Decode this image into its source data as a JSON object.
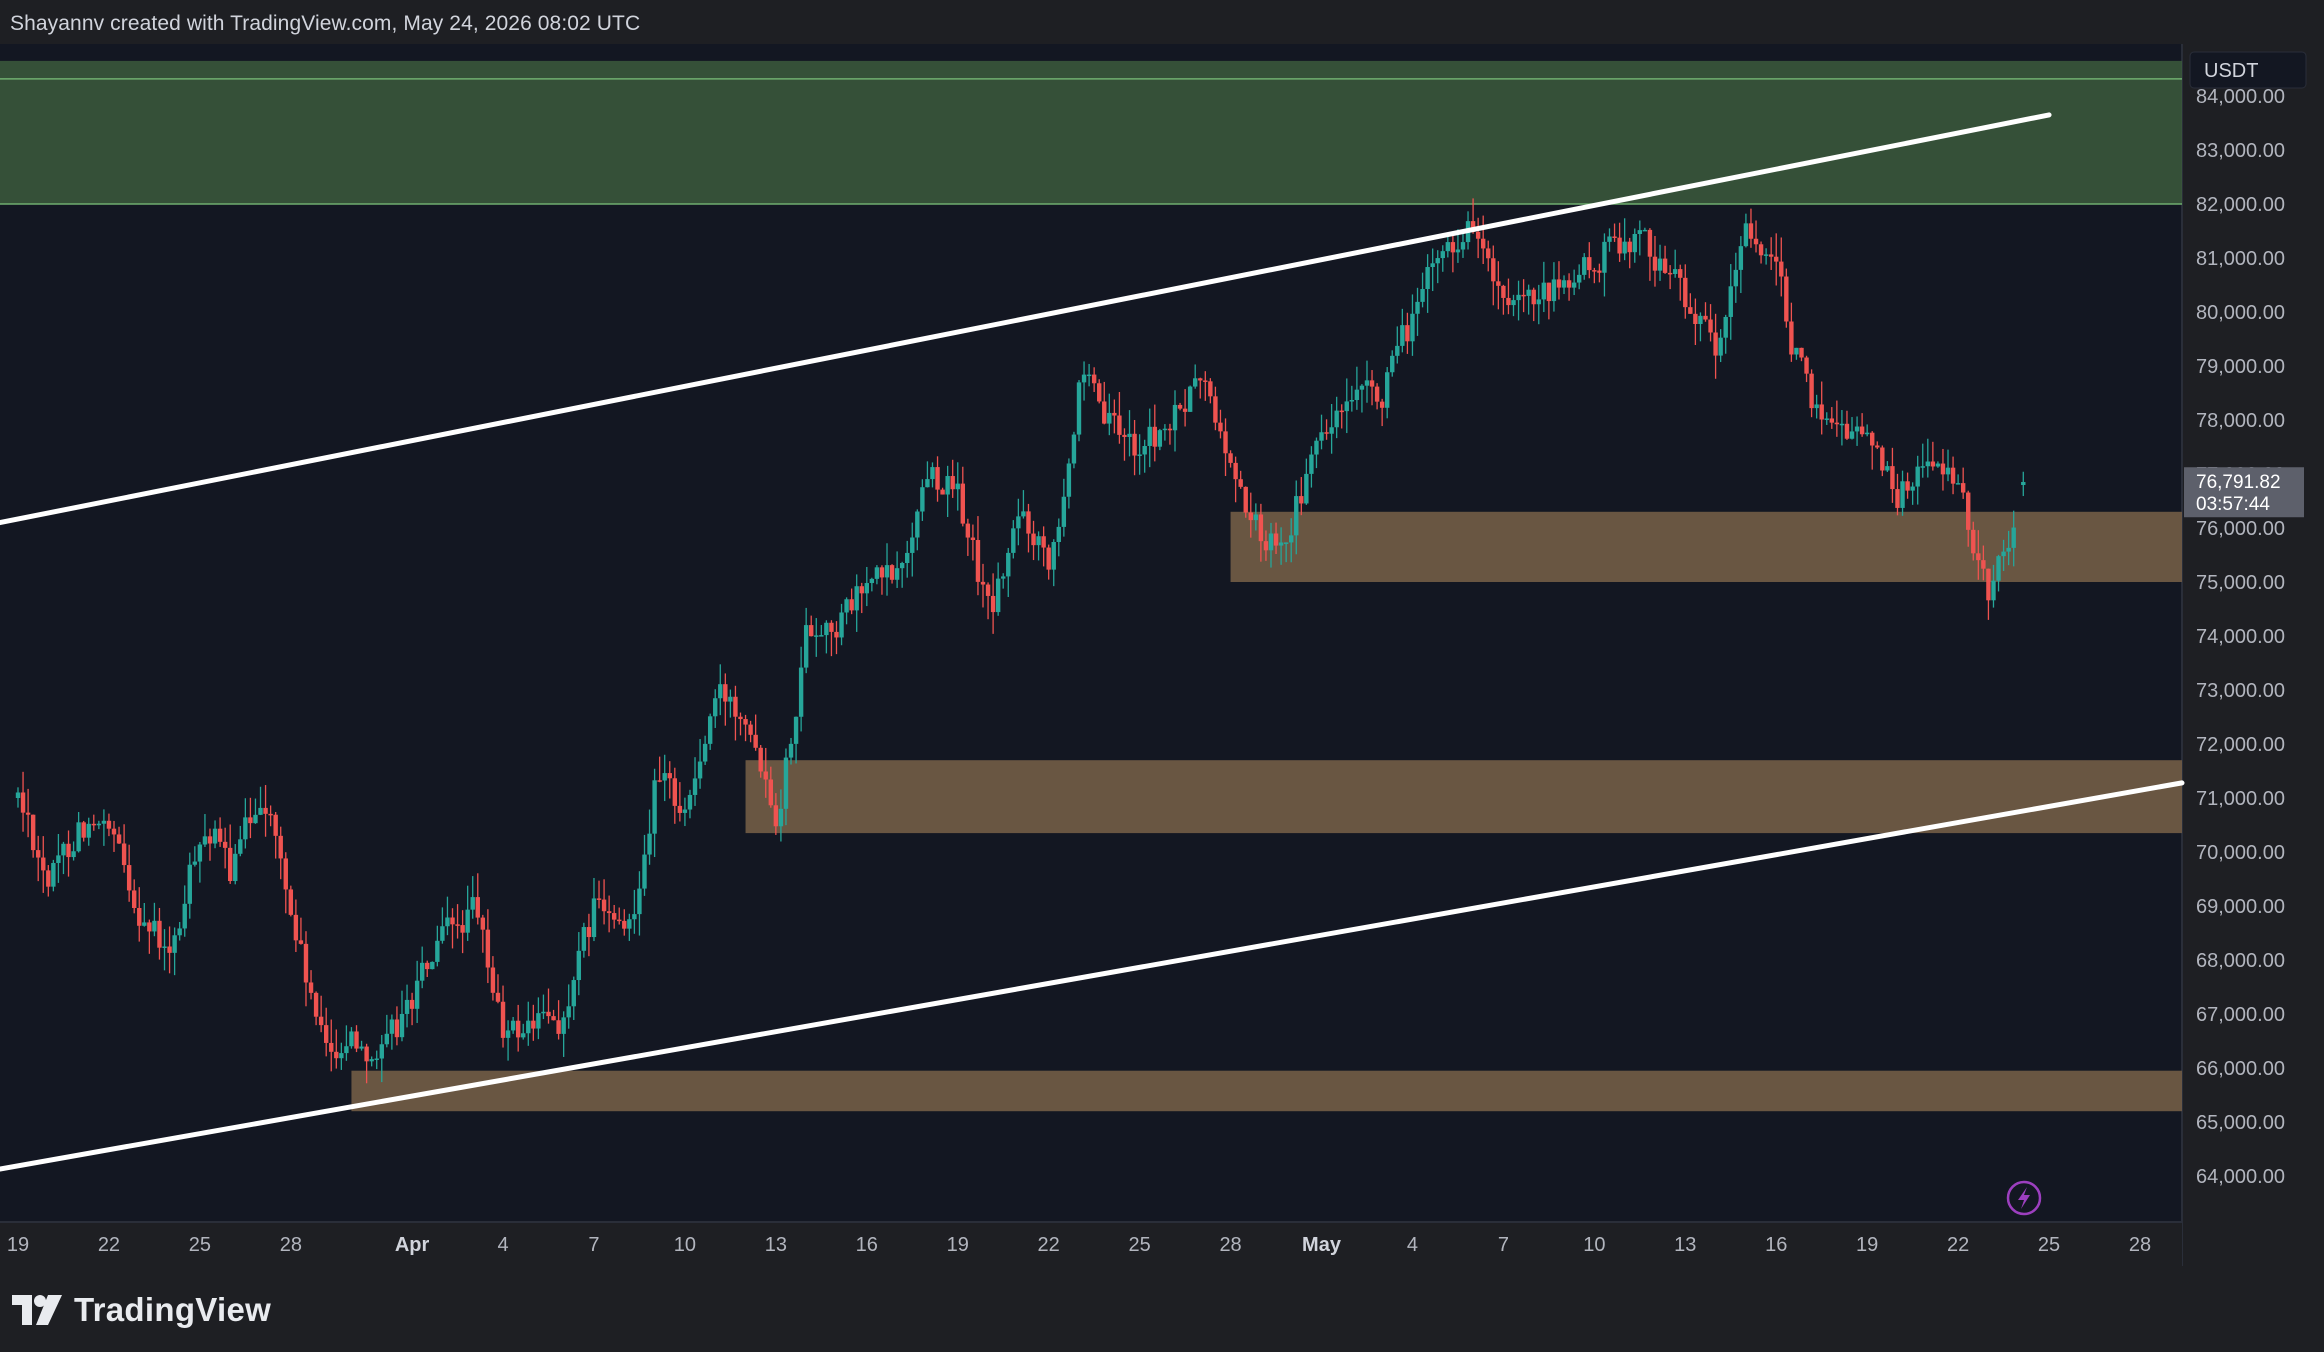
{
  "header": {
    "attribution": "Shayannv created with TradingView.com, May 24, 2026 08:02 UTC"
  },
  "footer": {
    "brand": "TradingView",
    "logo_icon": "tradingview-logo-icon"
  },
  "colors": {
    "background": "#131722",
    "outer": "#1e1f23",
    "up": "#26a69a",
    "down": "#ef5350",
    "supply_zone": "#3c5a3c",
    "demand_zone": "#6e5a44",
    "trendline": "#ffffff",
    "axis_text": "#b2b5be"
  },
  "price_label": {
    "price": "76,791.82",
    "countdown": "03:57:44"
  },
  "chart_data": {
    "type": "candlestick",
    "currency": "USDT",
    "x_labels": [
      "19",
      "22",
      "25",
      "28",
      "Apr",
      "4",
      "7",
      "10",
      "13",
      "16",
      "19",
      "22",
      "25",
      "28",
      "May",
      "4",
      "7",
      "10",
      "13",
      "16",
      "19",
      "22",
      "25",
      "28"
    ],
    "x_label_dates": [
      "2026-03-19",
      "2026-03-22",
      "2026-03-25",
      "2026-03-28",
      "2026-04-01",
      "2026-04-04",
      "2026-04-07",
      "2026-04-10",
      "2026-04-13",
      "2026-04-16",
      "2026-04-19",
      "2026-04-22",
      "2026-04-25",
      "2026-04-28",
      "2026-05-01",
      "2026-05-04",
      "2026-05-07",
      "2026-05-10",
      "2026-05-13",
      "2026-05-16",
      "2026-05-19",
      "2026-05-22",
      "2026-05-25",
      "2026-05-28"
    ],
    "y_ticks": [
      "64,000.00",
      "65,000.00",
      "66,000.00",
      "67,000.00",
      "68,000.00",
      "69,000.00",
      "70,000.00",
      "71,000.00",
      "72,000.00",
      "73,000.00",
      "74,000.00",
      "75,000.00",
      "76,000.00",
      "77,000.00",
      "78,000.00",
      "79,000.00",
      "80,000.00",
      "81,000.00",
      "82,000.00",
      "83,000.00",
      "84,000.00"
    ],
    "y_range": [
      63200,
      84600
    ],
    "x_range": [
      "2026-03-19",
      "2026-05-31"
    ],
    "last_price": 76791.82,
    "zones": [
      {
        "kind": "supply",
        "from": "2026-03-19",
        "to": "2026-05-31",
        "low": 82000,
        "high": 84650
      },
      {
        "kind": "demand",
        "from": "2026-04-28",
        "to": "2026-05-31",
        "low": 75000,
        "high": 76300
      },
      {
        "kind": "demand",
        "from": "2026-04-12",
        "to": "2026-05-31",
        "low": 70350,
        "high": 71700
      },
      {
        "kind": "demand",
        "from": "2026-03-30",
        "to": "2026-05-31",
        "low": 65200,
        "high": 65950
      }
    ],
    "trendlines": [
      {
        "from_date": "2026-03-19",
        "from_price": 76100,
        "to_date": "2026-05-25",
        "to_price": 83650
      },
      {
        "from_date": "2026-03-19",
        "from_price": 64130,
        "to_date": "2026-05-31",
        "to_price": 71280
      }
    ],
    "path": [
      {
        "date": "2026-03-19",
        "price": 71000
      },
      {
        "date": "2026-03-20",
        "price": 69400
      },
      {
        "date": "2026-03-21",
        "price": 70600
      },
      {
        "date": "2026-03-22",
        "price": 70200
      },
      {
        "date": "2026-03-23",
        "price": 68900
      },
      {
        "date": "2026-03-24",
        "price": 67900
      },
      {
        "date": "2026-03-25",
        "price": 70600
      },
      {
        "date": "2026-03-26",
        "price": 69600
      },
      {
        "date": "2026-03-27",
        "price": 71300
      },
      {
        "date": "2026-03-28",
        "price": 68700
      },
      {
        "date": "2026-03-29",
        "price": 66300
      },
      {
        "date": "2026-03-30",
        "price": 66600
      },
      {
        "date": "2026-03-31",
        "price": 66200
      },
      {
        "date": "2026-04-01",
        "price": 67400
      },
      {
        "date": "2026-04-02",
        "price": 68400
      },
      {
        "date": "2026-04-03",
        "price": 68900
      },
      {
        "date": "2026-04-04",
        "price": 66500
      },
      {
        "date": "2026-04-05",
        "price": 66900
      },
      {
        "date": "2026-04-06",
        "price": 66900
      },
      {
        "date": "2026-04-07",
        "price": 69100
      },
      {
        "date": "2026-04-08",
        "price": 68300
      },
      {
        "date": "2026-04-09",
        "price": 71400
      },
      {
        "date": "2026-04-10",
        "price": 70800
      },
      {
        "date": "2026-04-11",
        "price": 72900
      },
      {
        "date": "2026-04-12",
        "price": 72700
      },
      {
        "date": "2026-04-13",
        "price": 70700
      },
      {
        "date": "2026-04-14",
        "price": 74300
      },
      {
        "date": "2026-04-15",
        "price": 74200
      },
      {
        "date": "2026-04-16",
        "price": 75000
      },
      {
        "date": "2026-04-17",
        "price": 75100
      },
      {
        "date": "2026-04-18",
        "price": 77200
      },
      {
        "date": "2026-04-19",
        "price": 76500
      },
      {
        "date": "2026-04-20",
        "price": 74300
      },
      {
        "date": "2026-04-21",
        "price": 76300
      },
      {
        "date": "2026-04-22",
        "price": 75500
      },
      {
        "date": "2026-04-23",
        "price": 78700
      },
      {
        "date": "2026-04-24",
        "price": 77800
      },
      {
        "date": "2026-04-25",
        "price": 77500
      },
      {
        "date": "2026-04-26",
        "price": 77900
      },
      {
        "date": "2026-04-27",
        "price": 78800
      },
      {
        "date": "2026-04-28",
        "price": 77000
      },
      {
        "date": "2026-04-29",
        "price": 75700
      },
      {
        "date": "2026-04-30",
        "price": 76200
      },
      {
        "date": "2026-05-01",
        "price": 77800
      },
      {
        "date": "2026-05-02",
        "price": 78200
      },
      {
        "date": "2026-05-03",
        "price": 78500
      },
      {
        "date": "2026-05-04",
        "price": 80000
      },
      {
        "date": "2026-05-05",
        "price": 81200
      },
      {
        "date": "2026-05-06",
        "price": 81700
      },
      {
        "date": "2026-05-07",
        "price": 79800
      },
      {
        "date": "2026-05-08",
        "price": 80100
      },
      {
        "date": "2026-05-09",
        "price": 80500
      },
      {
        "date": "2026-05-10",
        "price": 80900
      },
      {
        "date": "2026-05-11",
        "price": 81500
      },
      {
        "date": "2026-05-12",
        "price": 81100
      },
      {
        "date": "2026-05-13",
        "price": 80300
      },
      {
        "date": "2026-05-14",
        "price": 79000
      },
      {
        "date": "2026-05-15",
        "price": 81800
      },
      {
        "date": "2026-05-16",
        "price": 80500
      },
      {
        "date": "2026-05-17",
        "price": 78300
      },
      {
        "date": "2026-05-18",
        "price": 78000
      },
      {
        "date": "2026-05-19",
        "price": 77700
      },
      {
        "date": "2026-05-20",
        "price": 76600
      },
      {
        "date": "2026-05-21",
        "price": 77400
      },
      {
        "date": "2026-05-22",
        "price": 76500
      },
      {
        "date": "2026-05-23",
        "price": 74700
      },
      {
        "date": "2026-05-24",
        "price": 76790
      }
    ]
  }
}
